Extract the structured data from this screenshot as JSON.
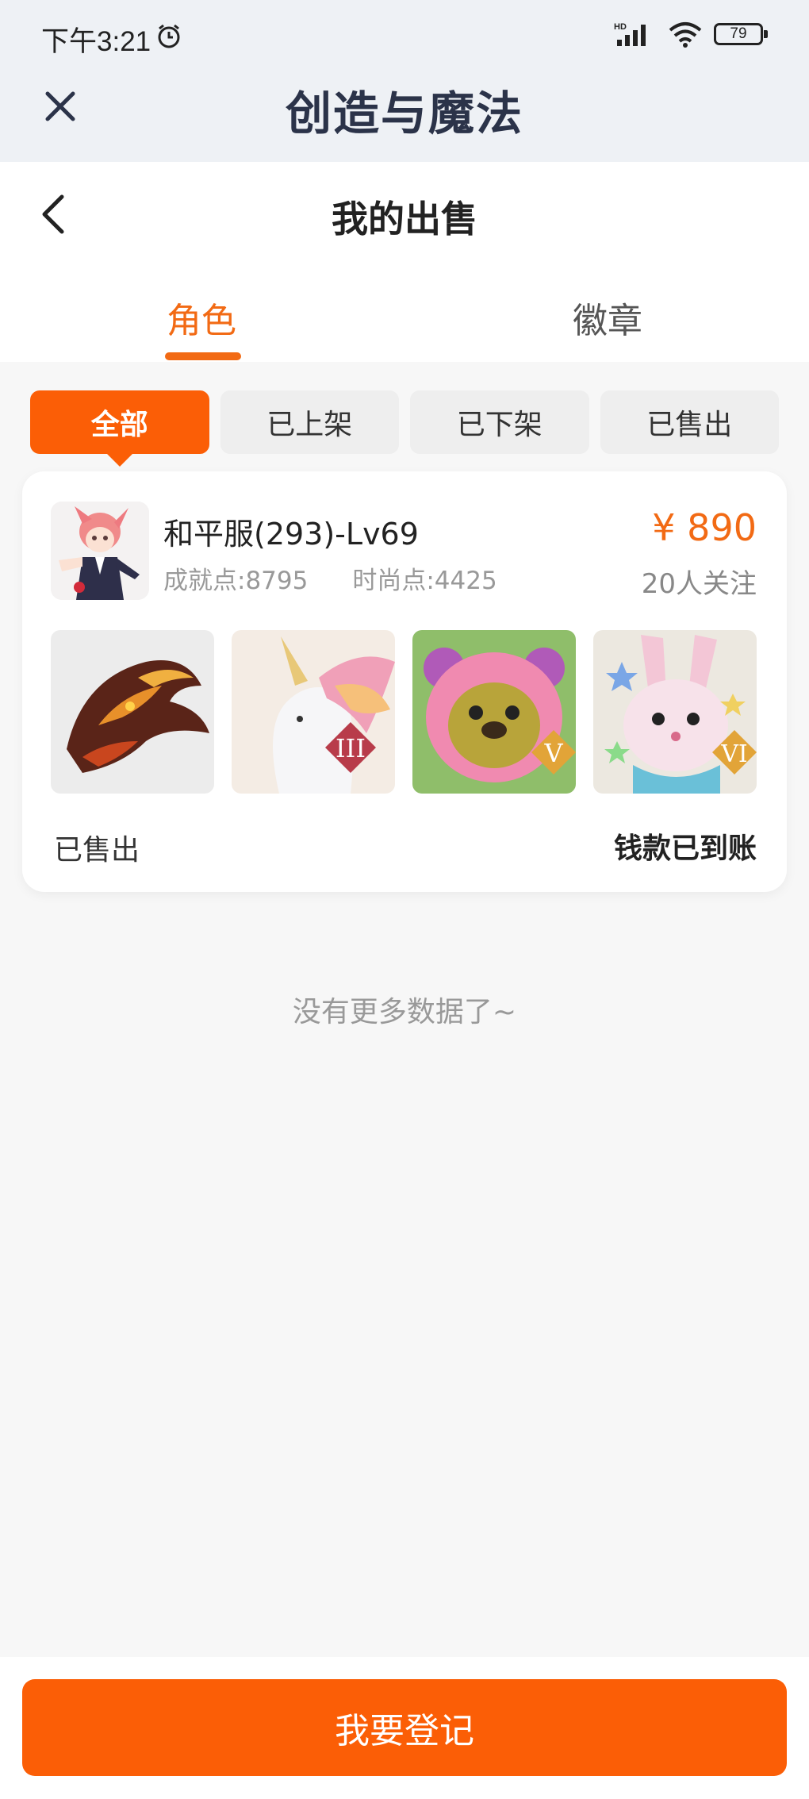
{
  "status_bar": {
    "time": "下午3:21",
    "network": "HD",
    "battery": "79"
  },
  "app": {
    "title": "创造与魔法"
  },
  "header": {
    "title": "我的出售"
  },
  "tabs": [
    {
      "label": "角色",
      "active": true
    },
    {
      "label": "徽章",
      "active": false
    }
  ],
  "filters": [
    {
      "label": "全部",
      "active": true
    },
    {
      "label": "已上架",
      "active": false
    },
    {
      "label": "已下架",
      "active": false
    },
    {
      "label": "已售出",
      "active": false
    }
  ],
  "listing": {
    "name": "和平服(293)-Lv69",
    "achievement": "成就点:8795",
    "fashion": "时尚点:4425",
    "price": "¥ 890",
    "followers": "20人关注",
    "items": [
      {
        "name": "fire-dragon-mount",
        "badge": ""
      },
      {
        "name": "unicorn-mount",
        "badge": "III"
      },
      {
        "name": "pink-bear-pet",
        "badge": "V"
      },
      {
        "name": "bunny-pet",
        "badge": "VI"
      }
    ],
    "status": "已售出",
    "payment_status": "钱款已到账"
  },
  "footer_note": "没有更多数据了~",
  "action": {
    "register_label": "我要登记"
  },
  "colors": {
    "accent": "#fb5e06",
    "accent_text": "#f26a14",
    "title_text": "#2b3349"
  }
}
